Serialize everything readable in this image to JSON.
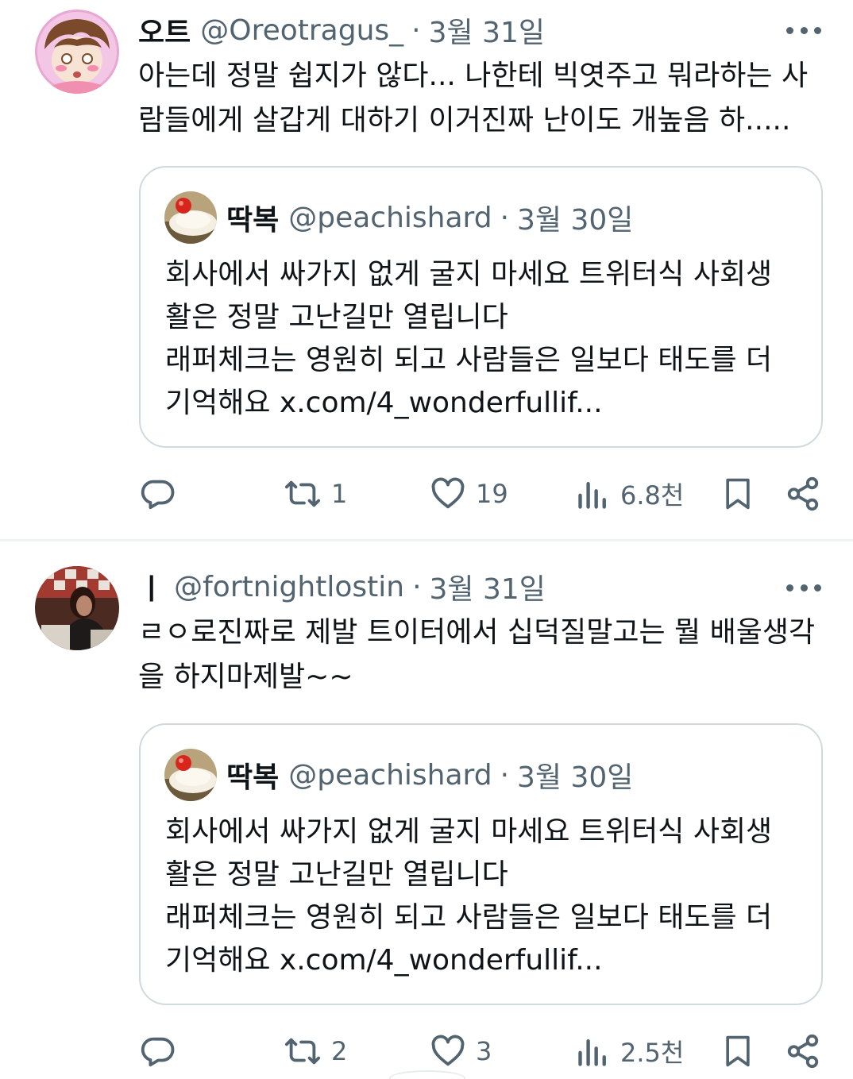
{
  "tweets": [
    {
      "display_name": "오트",
      "handle": "@Oreotragus_",
      "separator": "·",
      "date": "3월 31일",
      "lines": [
        "아는데 정말 쉽지가 않다... 나한테 빅엿주고 뭐라하는 사",
        "람들에게 살갑게 대하기 이거진짜 난이도 개높음 하....."
      ],
      "quote": {
        "display_name": "딱복",
        "handle": "@peachishard",
        "separator": "·",
        "date": "3월 30일",
        "lines": [
          "회사에서 싸가지 없게 굴지 마세요 트위터식 사회생",
          "활은 정말 고난길만 열립니다",
          "래퍼체크는 영원히 되고 사람들은 일보다 태도를 더",
          "기억해요 x.com/4_wonderfullif..."
        ]
      },
      "actions": {
        "reply": "",
        "retweet": "1",
        "like": "19",
        "views": "6.8천"
      }
    },
    {
      "display_name": "ㅣ",
      "handle": "@fortnightlostin",
      "separator": "·",
      "date": "3월 31일",
      "lines": [
        "ㄹㅇ로진짜로 제발 트이터에서 십덕질말고는 뭘 배울생각",
        "을 하지마제발~~"
      ],
      "quote": {
        "display_name": "딱복",
        "handle": "@peachishard",
        "separator": "·",
        "date": "3월 30일",
        "lines": [
          "회사에서 싸가지 없게 굴지 마세요 트위터식 사회생",
          "활은 정말 고난길만 열립니다",
          "래퍼체크는 영원히 되고 사람들은 일보다 태도를 더",
          "기억해요 x.com/4_wonderfullif..."
        ]
      },
      "actions": {
        "reply": "",
        "retweet": "2",
        "like": "3",
        "views": "2.5천"
      }
    }
  ],
  "icons": {
    "reply": "speech-bubble-icon",
    "retweet": "retweet-arrows-icon",
    "like": "heart-icon",
    "views": "bar-chart-icon",
    "bookmark": "bookmark-icon",
    "share": "share-nodes-icon",
    "more": "more-dots-icon"
  },
  "colors": {
    "text_primary": "#0f1419",
    "text_secondary": "#536471",
    "border": "#cfd9de",
    "divider": "#eff3f4"
  }
}
